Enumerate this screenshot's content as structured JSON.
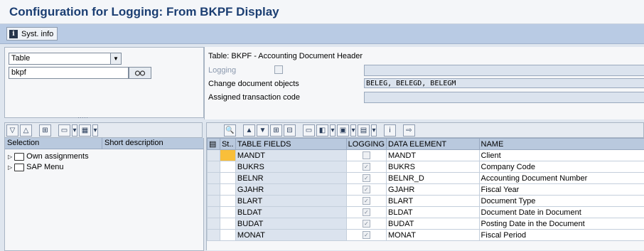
{
  "window": {
    "title": "Configuration for Logging: From BKPF Display"
  },
  "toolbar": {
    "syst_info_label": "Syst. info"
  },
  "selector": {
    "object_type": "Table",
    "object_name": "bkpf"
  },
  "details": {
    "table_line": "Table: BKPF - Accounting Document Header",
    "logging_label": "Logging",
    "change_doc_label": "Change document objects",
    "change_doc_value": "BELEG, BELEGD, BELEGM",
    "assigned_tcode_label": "Assigned transaction code"
  },
  "tree": {
    "columns": [
      "Selection",
      "Short description"
    ],
    "items": [
      {
        "label": "Own assignments"
      },
      {
        "label": "SAP Menu"
      }
    ]
  },
  "grid": {
    "columns": [
      "St..",
      "TABLE FIELDS",
      "LOGGING",
      "DATA ELEMENT",
      "NAME"
    ],
    "rows": [
      {
        "field": "MANDT",
        "data_element": "MANDT",
        "name": "Client",
        "logging": false
      },
      {
        "field": "BUKRS",
        "data_element": "BUKRS",
        "name": "Company Code",
        "logging": true
      },
      {
        "field": "BELNR",
        "data_element": "BELNR_D",
        "name": "Accounting Document Number",
        "logging": true
      },
      {
        "field": "GJAHR",
        "data_element": "GJAHR",
        "name": "Fiscal Year",
        "logging": true
      },
      {
        "field": "BLART",
        "data_element": "BLART",
        "name": "Document Type",
        "logging": true
      },
      {
        "field": "BLDAT",
        "data_element": "BLDAT",
        "name": "Document Date in Document",
        "logging": true
      },
      {
        "field": "BUDAT",
        "data_element": "BUDAT",
        "name": "Posting Date in the Document",
        "logging": true
      },
      {
        "field": "MONAT",
        "data_element": "MONAT",
        "name": "Fiscal Period",
        "logging": true
      }
    ]
  },
  "icons": {
    "syst_info": "info-icon",
    "execute": "glasses-icon",
    "checked_mark": "✓"
  },
  "colors": {
    "title": "#1b3e72",
    "highlight": "#f9bf3a"
  }
}
